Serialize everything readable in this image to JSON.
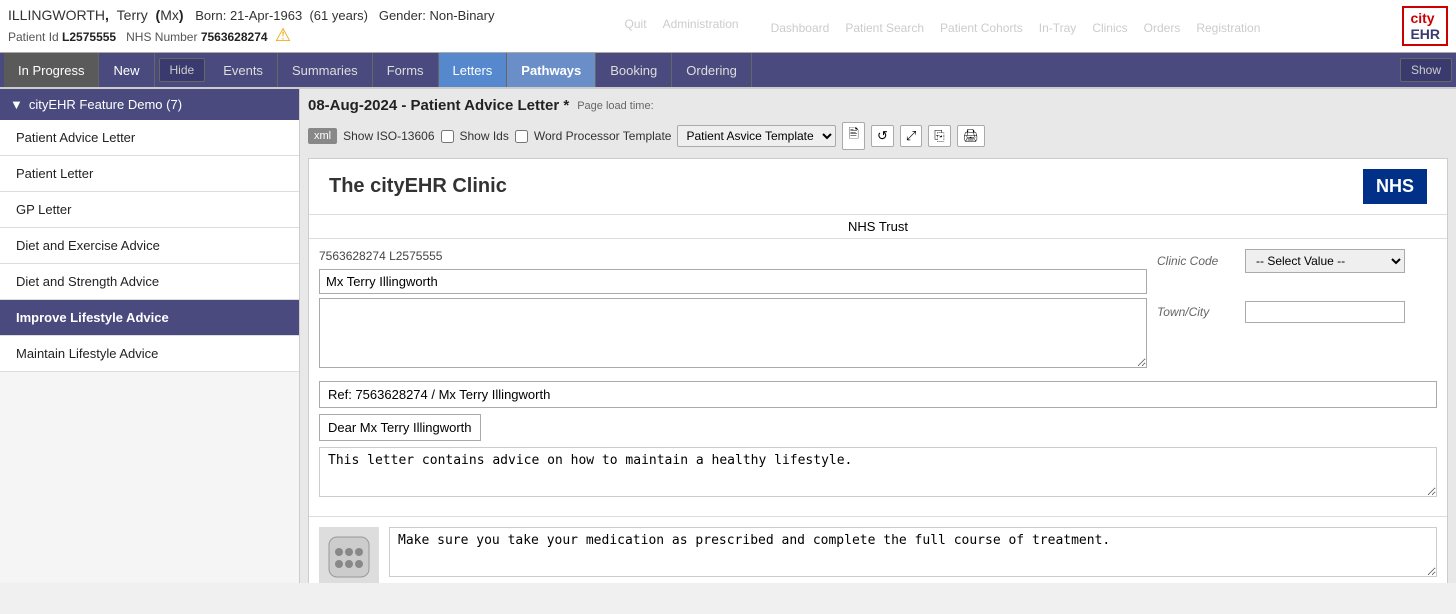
{
  "patient": {
    "last_name": "ILLINGWORTH",
    "first_name": "Terry",
    "prefix": "Mx",
    "dob_label": "Born:",
    "dob": "21-Apr-1963",
    "age": "61 years",
    "gender_label": "Gender:",
    "gender": "Non-Binary",
    "patient_id_label": "Patient Id",
    "patient_id": "L2575555",
    "nhs_label": "NHS Number",
    "nhs_number": "7563628274"
  },
  "top_nav": {
    "quit": "Quit",
    "administration": "Administration",
    "dashboard": "Dashboard",
    "patient_search": "Patient Search",
    "patient_cohorts": "Patient Cohorts",
    "in_tray": "In-Tray",
    "clinics": "Clinics",
    "orders": "Orders",
    "registration": "Registration",
    "logo_city": "city",
    "logo_ehr": "EHR"
  },
  "tabs": {
    "hide_label": "Hide",
    "show_label": "Show",
    "in_progress": "In Progress",
    "new_tab": "New",
    "events": "Events",
    "summaries": "Summaries",
    "forms": "Forms",
    "letters": "Letters",
    "pathways": "Pathways",
    "booking": "Booking",
    "ordering": "Ordering"
  },
  "sidebar": {
    "header": "cityEHR Feature Demo (7)",
    "items": [
      {
        "id": "patient-advice-letter",
        "label": "Patient Advice Letter"
      },
      {
        "id": "patient-letter",
        "label": "Patient Letter"
      },
      {
        "id": "gp-letter",
        "label": "GP Letter"
      },
      {
        "id": "diet-exercise-advice",
        "label": "Diet and Exercise Advice"
      },
      {
        "id": "diet-strength-advice",
        "label": "Diet and Strength Advice"
      },
      {
        "id": "improve-lifestyle-advice",
        "label": "Improve Lifestyle Advice"
      },
      {
        "id": "maintain-lifestyle-advice",
        "label": "Maintain Lifestyle Advice"
      }
    ]
  },
  "page": {
    "title": "08-Aug-2024 - Patient Advice Letter *",
    "page_load_label": "Page load time:",
    "xml_btn": "xml",
    "show_iso_label": "Show ISO-13606",
    "show_ids_label": "Show Ids",
    "word_processor_label": "Word Processor Template",
    "template_options": [
      "Patient Asvice Template"
    ],
    "selected_template": "Patient Asvice Template"
  },
  "toolbar_icons": {
    "page_icon": "🖹",
    "refresh_icon": "↺",
    "expand_icon": "⤢",
    "copy_icon": "⎘",
    "print_icon": "🖨"
  },
  "letter": {
    "clinic_name": "The cityEHR Clinic",
    "nhs_logo": "NHS",
    "nhs_trust": "NHS Trust",
    "patient_ref": "7563628274 L2575555",
    "patient_name_field": "Mx Terry Illingworth",
    "clinic_code_label": "Clinic Code",
    "clinic_code_placeholder": "-- Select Value --",
    "town_city_label": "Town/City",
    "town_city_value": "",
    "ref_line": "Ref: 7563628274 / Mx Terry Illingworth",
    "dear_line": "Dear Mx Terry Illingworth",
    "intro_text": "This letter contains advice on how to maintain a healthy lifestyle.",
    "medication_text": "Make sure you take your medication as prescribed and complete the full course of treatment."
  }
}
